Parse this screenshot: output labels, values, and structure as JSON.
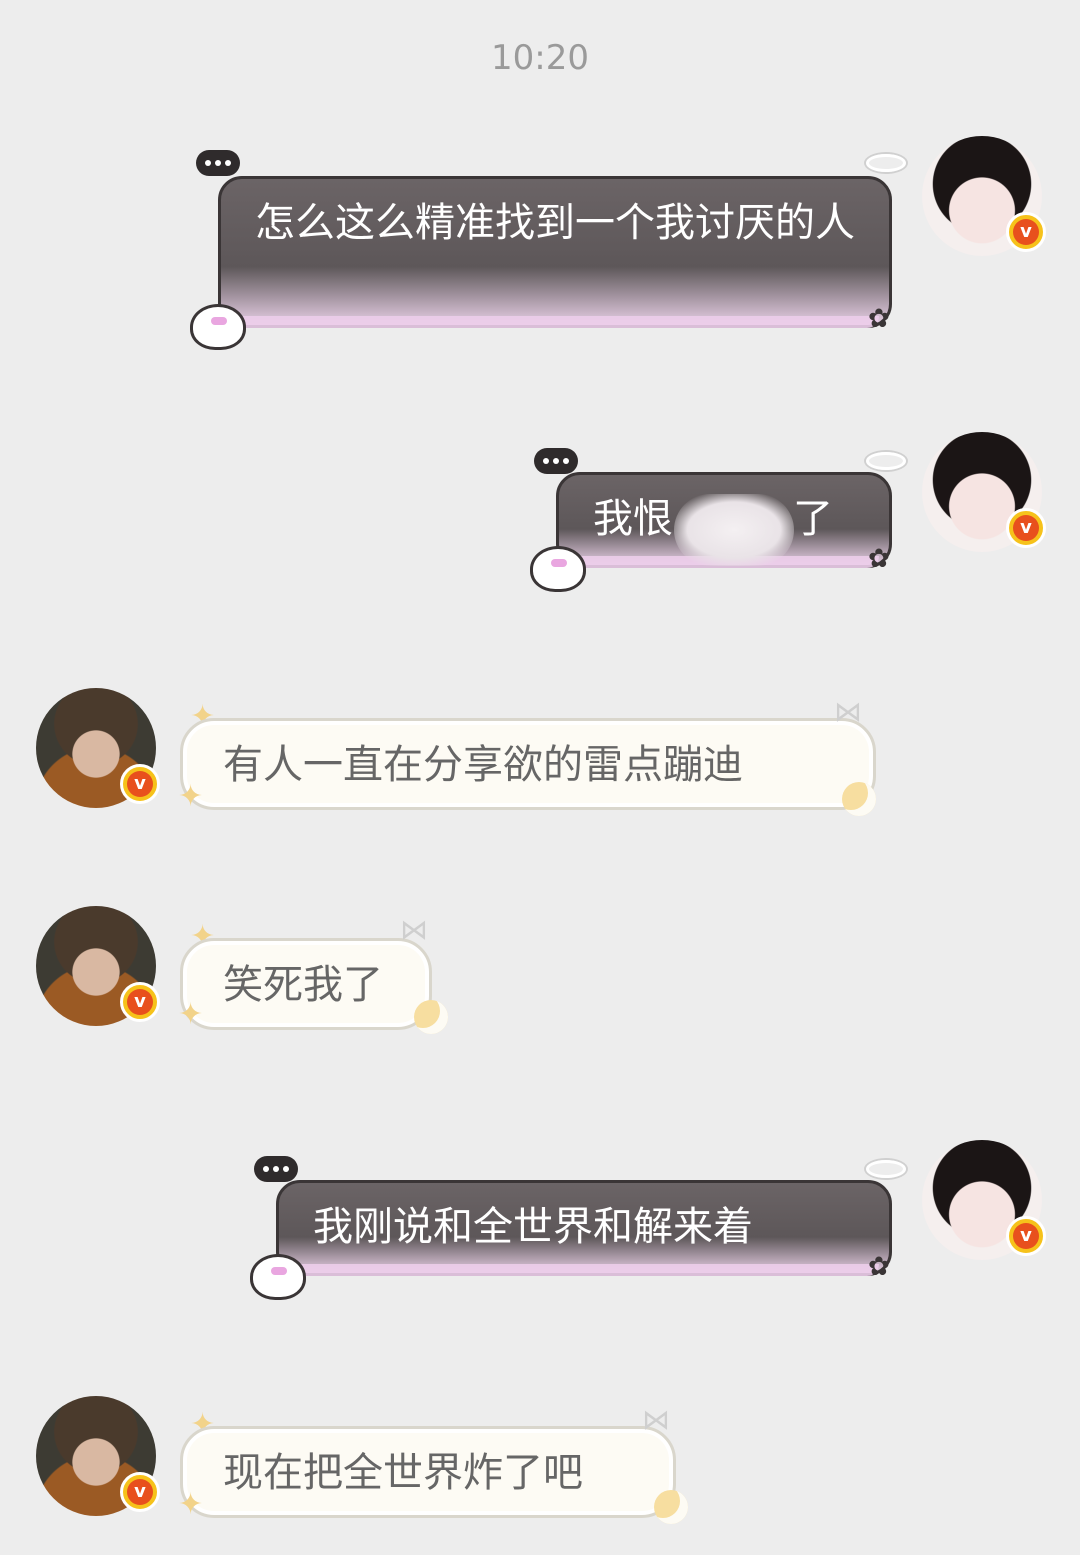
{
  "chat": {
    "timestamp": "10:20",
    "messages": [
      {
        "sender": "self",
        "text": "怎么这么精准找到一个我讨厌的人"
      },
      {
        "sender": "self",
        "text_before": "我恨",
        "text_after": "了"
      },
      {
        "sender": "other",
        "text": "有人一直在分享欲的雷点蹦迪"
      },
      {
        "sender": "other",
        "text": "笑死我了"
      },
      {
        "sender": "self",
        "text": "我刚说和全世界和解来着"
      },
      {
        "sender": "other",
        "text": "现在把全世界炸了吧"
      }
    ]
  },
  "badge": {
    "label": "v"
  },
  "icons": {
    "typing": "typing-dots-icon",
    "bunny": "bunny-sticker-icon",
    "halo": "halo-icon",
    "bow": "bow-icon",
    "star": "sparkle-star-icon",
    "moon": "crescent-moon-icon",
    "ribbon": "ribbon-icon"
  },
  "colors": {
    "background": "#ededed",
    "dark_bubble": "#5d5759",
    "light_bubble": "#fdfbf4",
    "verified_badge": "#e8501d"
  }
}
